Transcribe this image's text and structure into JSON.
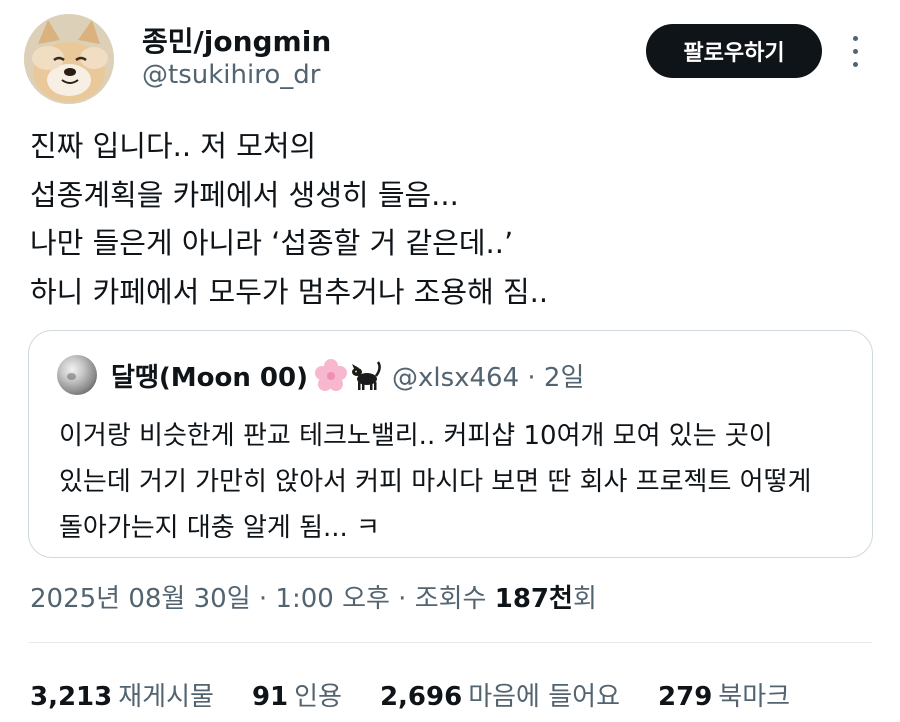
{
  "author": {
    "name": "종민/jongmin",
    "handle": "@tsukihiro_dr",
    "avatar_icon": "dog-avatar-icon"
  },
  "actions": {
    "follow_label": "팔로우하기",
    "more_icon": "more-vertical-icon"
  },
  "tweet": {
    "lines": [
      "진짜 입니다.. 저 모처의",
      "섭종계획을 카페에서 생생히 들음...",
      "나만 들은게 아니라 ‘섭종할 거 같은데..’",
      "하니 카페에서 모두가 멈추거나 조용해 짐.."
    ]
  },
  "quote": {
    "name": "달땡(Moon 00)",
    "emojis": [
      "cherry-blossom-icon",
      "black-cat-icon"
    ],
    "handle": "@xlsx464 · 2일",
    "avatar_icon": "moon-avatar-icon",
    "lines": [
      "이거랑 비슷한게 판교 테크노밸리.. 커피샵 10여개 모여 있는 곳이",
      "있는데 거기 가만히 앉아서 커피 마시다 보면 딴 회사 프로젝트 어떻게",
      "돌아가는지 대충 알게 됨... ㅋ"
    ]
  },
  "meta": {
    "datetime": "2025년 08월 30일 · 1:00 오후 · 조회수 ",
    "views": "187천",
    "views_suffix": "회"
  },
  "stats": [
    {
      "count": "3,213",
      "label": "재게시물"
    },
    {
      "count": "91",
      "label": "인용"
    },
    {
      "count": "2,696",
      "label": "마음에 들어요"
    },
    {
      "count": "279",
      "label": "북마크"
    }
  ]
}
